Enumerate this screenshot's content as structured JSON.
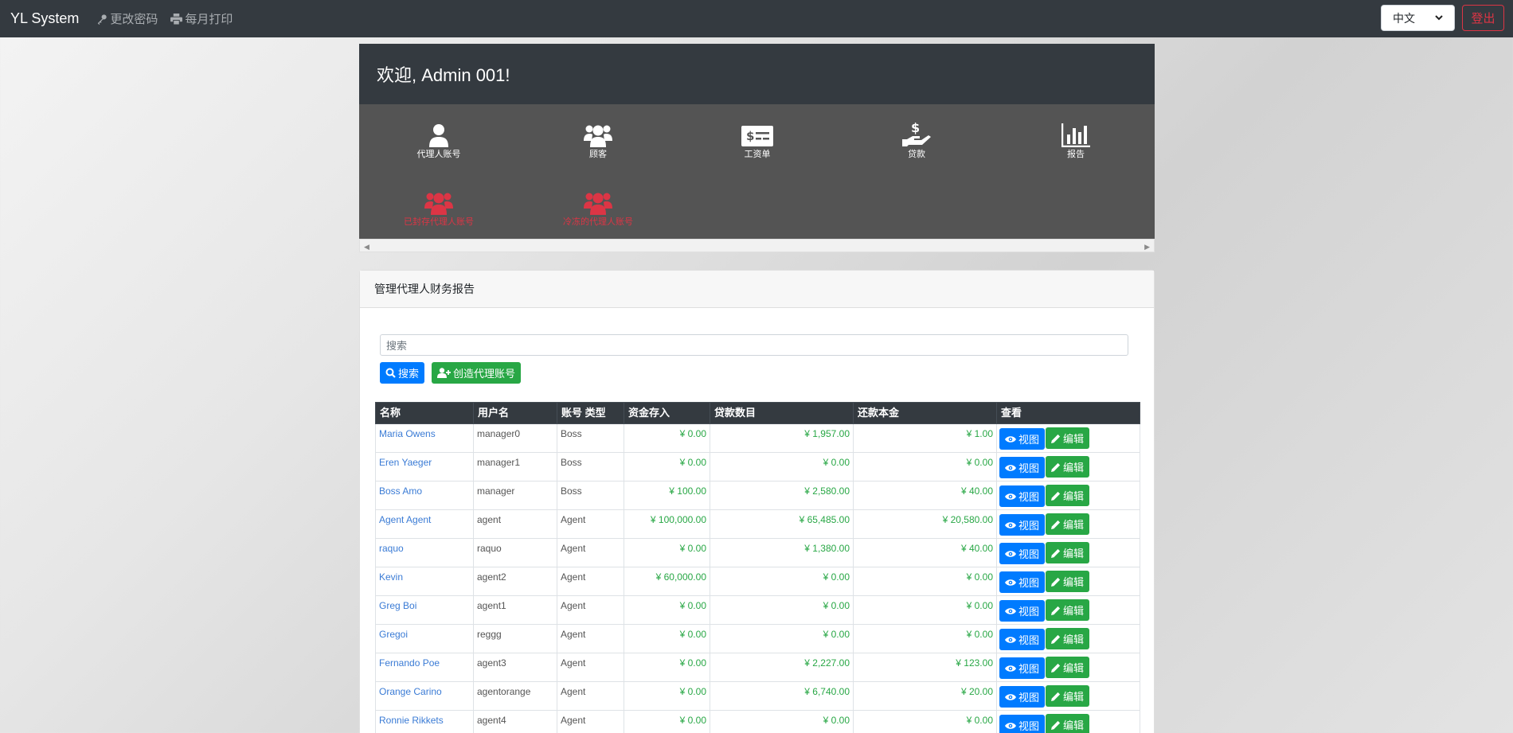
{
  "navbar": {
    "brand": "YL System",
    "change_password": "更改密码",
    "monthly_print": "每月打印",
    "language": "中文",
    "logout": "登出"
  },
  "dashboard": {
    "welcome": "欢迎, Admin 001!",
    "tiles": [
      {
        "label": "代理人账号",
        "icon": "user-icon",
        "color": "#ffffff"
      },
      {
        "label": "顾客",
        "icon": "users-icon",
        "color": "#ffffff"
      },
      {
        "label": "工资单",
        "icon": "money-check-icon",
        "color": "#ffffff"
      },
      {
        "label": "贷款",
        "icon": "hand-holding-dollar-icon",
        "color": "#ffffff"
      },
      {
        "label": "报告",
        "icon": "chart-bar-icon",
        "color": "#ffffff"
      },
      {
        "label": "已封存代理人账号",
        "icon": "users-icon",
        "color": "#dc3545"
      },
      {
        "label": "冷冻的代理人账号",
        "icon": "users-icon",
        "color": "#dc3545"
      }
    ]
  },
  "card": {
    "title": "管理代理人财务报告",
    "search_placeholder": "搜索",
    "search_button": "搜索",
    "create_button": "创造代理账号"
  },
  "table": {
    "headers": [
      "名称",
      "用户名",
      "账号 类型",
      "资金存入",
      "贷款数目",
      "还款本金",
      "查看"
    ],
    "view_label": "视图",
    "edit_label": "编辑",
    "rows": [
      {
        "name": "Maria Owens",
        "username": "manager0",
        "type": "Boss",
        "deposit": "¥ 0.00",
        "loan": "¥ 1,957.00",
        "principal": "¥ 1.00"
      },
      {
        "name": "Eren Yaeger",
        "username": "manager1",
        "type": "Boss",
        "deposit": "¥ 0.00",
        "loan": "¥ 0.00",
        "principal": "¥ 0.00"
      },
      {
        "name": "Boss Amo",
        "username": "manager",
        "type": "Boss",
        "deposit": "¥ 100.00",
        "loan": "¥ 2,580.00",
        "principal": "¥ 40.00"
      },
      {
        "name": "Agent Agent",
        "username": "agent",
        "type": "Agent",
        "deposit": "¥ 100,000.00",
        "loan": "¥ 65,485.00",
        "principal": "¥ 20,580.00"
      },
      {
        "name": "raquo",
        "username": "raquo",
        "type": "Agent",
        "deposit": "¥ 0.00",
        "loan": "¥ 1,380.00",
        "principal": "¥ 40.00"
      },
      {
        "name": "Kevin",
        "username": "agent2",
        "type": "Agent",
        "deposit": "¥ 60,000.00",
        "loan": "¥ 0.00",
        "principal": "¥ 0.00"
      },
      {
        "name": "Greg Boi",
        "username": "agent1",
        "type": "Agent",
        "deposit": "¥ 0.00",
        "loan": "¥ 0.00",
        "principal": "¥ 0.00"
      },
      {
        "name": "Gregoi",
        "username": "reggg",
        "type": "Agent",
        "deposit": "¥ 0.00",
        "loan": "¥ 0.00",
        "principal": "¥ 0.00"
      },
      {
        "name": "Fernando Poe",
        "username": "agent3",
        "type": "Agent",
        "deposit": "¥ 0.00",
        "loan": "¥ 2,227.00",
        "principal": "¥ 123.00"
      },
      {
        "name": "Orange Carino",
        "username": "agentorange",
        "type": "Agent",
        "deposit": "¥ 0.00",
        "loan": "¥ 6,740.00",
        "principal": "¥ 20.00"
      },
      {
        "name": "Ronnie Rikkets",
        "username": "agent4",
        "type": "Agent",
        "deposit": "¥ 0.00",
        "loan": "¥ 0.00",
        "principal": "¥ 0.00"
      }
    ]
  }
}
